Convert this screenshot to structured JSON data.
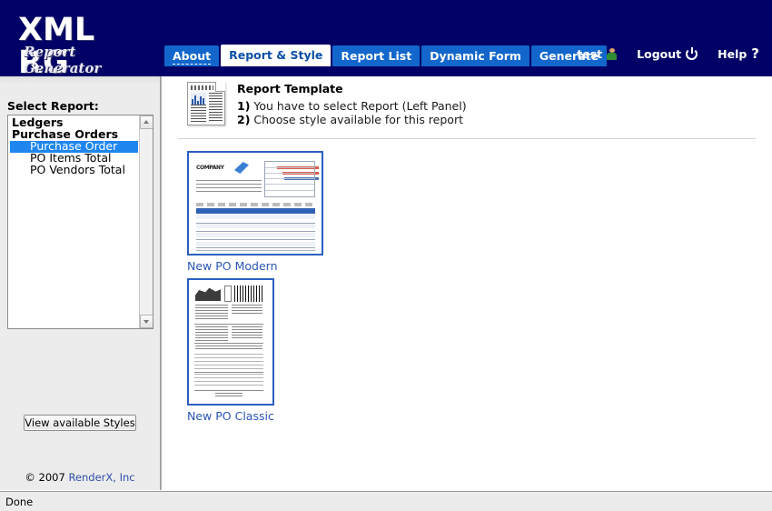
{
  "brand": {
    "title": "XML RG",
    "subtitle": "Report Generator",
    "header_bg": "#000066",
    "tab_bg": "#1266cc",
    "accent_link": "#2a55b5"
  },
  "tabs": [
    {
      "label": "About",
      "active": false,
      "underlined": true
    },
    {
      "label": "Report & Style",
      "active": true,
      "underlined": false
    },
    {
      "label": "Report List",
      "active": false,
      "underlined": false
    },
    {
      "label": "Dynamic Form",
      "active": false,
      "underlined": false
    },
    {
      "label": "Generate",
      "active": false,
      "underlined": false
    }
  ],
  "userbar": {
    "user_label": "test",
    "user_icon": "user-icon",
    "logout_label": "Logout",
    "logout_icon": "power-icon",
    "help_label": "Help",
    "help_icon": "question-mark-icon"
  },
  "sidebar": {
    "select_report_label": "Select Report:",
    "list": [
      {
        "label": "Ledgers",
        "type": "group",
        "selected": false
      },
      {
        "label": "Purchase Orders",
        "type": "group",
        "selected": false
      },
      {
        "label": "Purchase Order",
        "type": "item",
        "selected": true
      },
      {
        "label": "PO Items Total",
        "type": "item",
        "selected": false
      },
      {
        "label": "PO Vendors Total",
        "type": "item",
        "selected": false
      }
    ],
    "view_styles_button": "View available Styles",
    "copyright_prefix": "© 2007 ",
    "copyright_link": "RenderX, Inc"
  },
  "main": {
    "template_heading": "Report Template",
    "instruction_1_num": "1)",
    "instruction_1_text": " You have to select Report (Left Panel)",
    "instruction_2_num": "2)",
    "instruction_2_text": " Choose style available for this report",
    "doc_icon": "document-icon",
    "styles": [
      {
        "label": "New PO Modern",
        "orientation": "landscape"
      },
      {
        "label": "New PO Classic",
        "orientation": "portrait"
      }
    ]
  },
  "statusbar": {
    "text": "Done"
  }
}
